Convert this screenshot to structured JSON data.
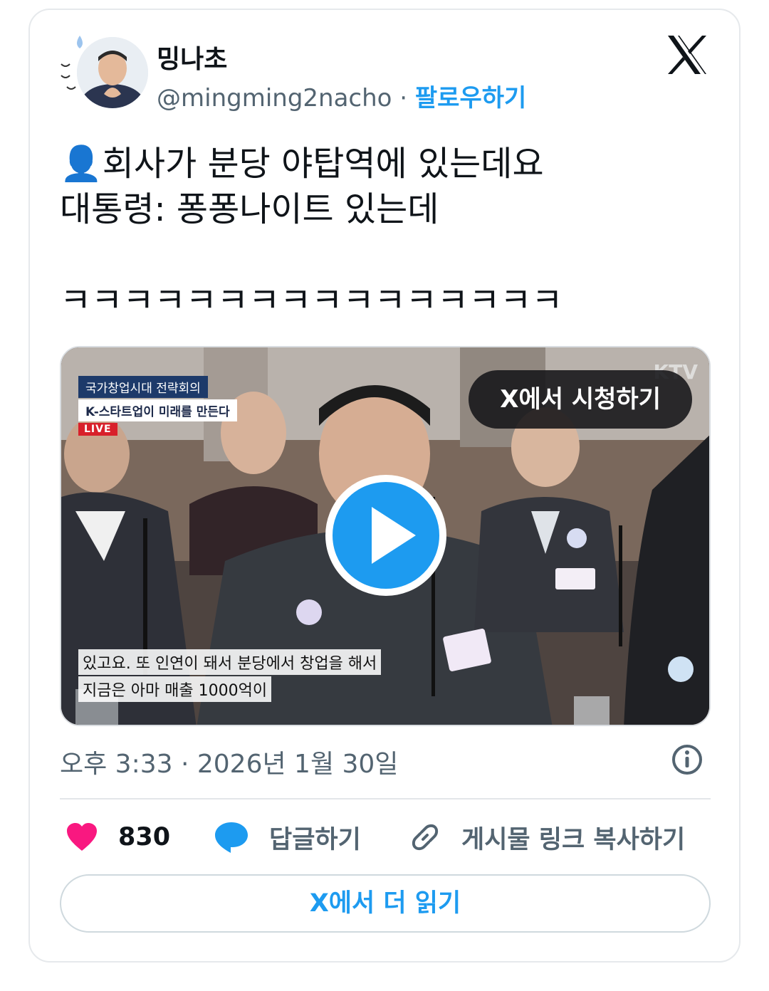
{
  "author": {
    "name": "밍나초",
    "handle": "@mingming2nacho",
    "separator": "·",
    "follow_label": "팔로우하기"
  },
  "tweet": {
    "text": "👤회사가 분당 야탑역에 있는데요\n대통령: 퐁퐁나이트 있는데\n\nㅋㅋㅋㅋㅋㅋㅋㅋㅋㅋㅋㅋㅋㅋㅋㅋ"
  },
  "video": {
    "watch_label": "X에서 시청하기",
    "overlay_line1": "국가창업시대 전략회의",
    "overlay_line2": "K-스타트업이 미래를 만든다",
    "live_badge": "LIVE",
    "watermark": "KTV",
    "subtitle_line1": "있고요. 또 인연이 돼서 분당에서 창업을 해서",
    "subtitle_line2": "지금은 아마 매출 1000억이"
  },
  "meta": {
    "timestamp": "오후 3:33 · 2026년 1월 30일"
  },
  "actions": {
    "like_count": "830",
    "reply_label": "답글하기",
    "copy_link_label": "게시물 링크 복사하기"
  },
  "footer": {
    "read_more_label": "X에서 더 읽기"
  },
  "colors": {
    "accent": "#1d9bf0",
    "like": "#f91880",
    "muted": "#536471"
  }
}
